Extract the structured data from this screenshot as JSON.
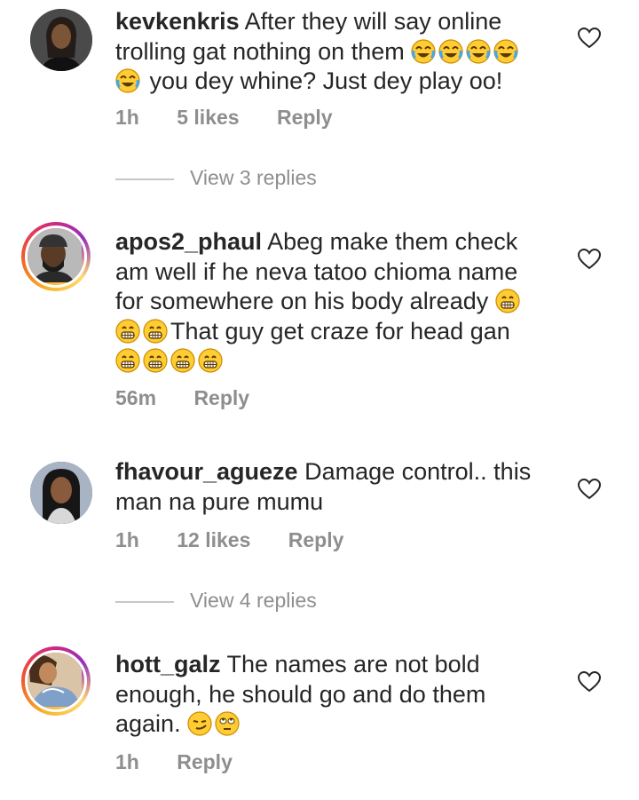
{
  "comments": [
    {
      "username": "kevkenkris",
      "text_a": "After they will say online trolling gat nothing on them",
      "text_b": "you dey whine? Just dey play oo!",
      "time": "1h",
      "likes": "5 likes",
      "reply": "Reply",
      "view_replies": "View 3 replies",
      "emoji_a": [
        "joy-emoji",
        "joy-emoji",
        "joy-emoji",
        "joy-emoji"
      ],
      "emoji_b": [
        "joy-emoji"
      ]
    },
    {
      "username": "apos2_phaul",
      "text_a": "Abeg make them check am well if he neva tatoo chioma name for somewhere on his body already",
      "text_b": "That guy get craze for head gan",
      "time": "56m",
      "reply": "Reply"
    },
    {
      "username": "fhavour_agueze",
      "text_a": "Damage control.. this man na pure mumu",
      "time": "1h",
      "likes": "12 likes",
      "reply": "Reply",
      "view_replies": "View 4 replies"
    },
    {
      "username": "hott_galz",
      "text_a": "The names are not bold enough, he should go and do them again.",
      "time": "1h",
      "reply": "Reply"
    }
  ],
  "colors": {
    "text": "#262626",
    "muted": "#8e8e8e",
    "divider": "#c7c7c7"
  },
  "icons": {
    "like": "heart-outline-icon"
  }
}
